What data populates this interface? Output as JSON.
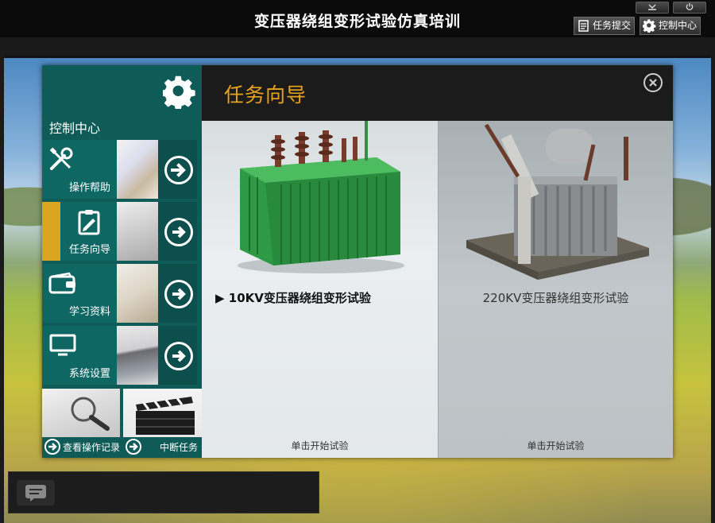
{
  "app": {
    "title": "变压器绕组变形试验仿真培训",
    "submit_task_label": "任务提交",
    "control_center_label": "控制中心"
  },
  "sidebar": {
    "header": "控制中心",
    "items": [
      {
        "label": "操作帮助",
        "icon": "tools-icon"
      },
      {
        "label": "任务向导",
        "icon": "clipboard-icon",
        "active": true
      },
      {
        "label": "学习资料",
        "icon": "wallet-icon"
      },
      {
        "label": "系统设置",
        "icon": "monitor-icon"
      }
    ],
    "bottom": [
      {
        "label": "查看操作记录",
        "icon": "magnifier-image"
      },
      {
        "label": "中断任务",
        "icon": "clapperboard-image"
      }
    ]
  },
  "content": {
    "title": "任务向导",
    "cards": [
      {
        "title": "▶ 10KV变压器绕组变形试验",
        "action": "单击开始试验",
        "selected": true
      },
      {
        "title": "220KV变压器绕组变形试验",
        "action": "单击开始试验",
        "selected": false
      }
    ]
  },
  "colors": {
    "sidebar": "#0e5b58",
    "accent": "#e8a21c",
    "active_marker": "#d9a41f"
  }
}
